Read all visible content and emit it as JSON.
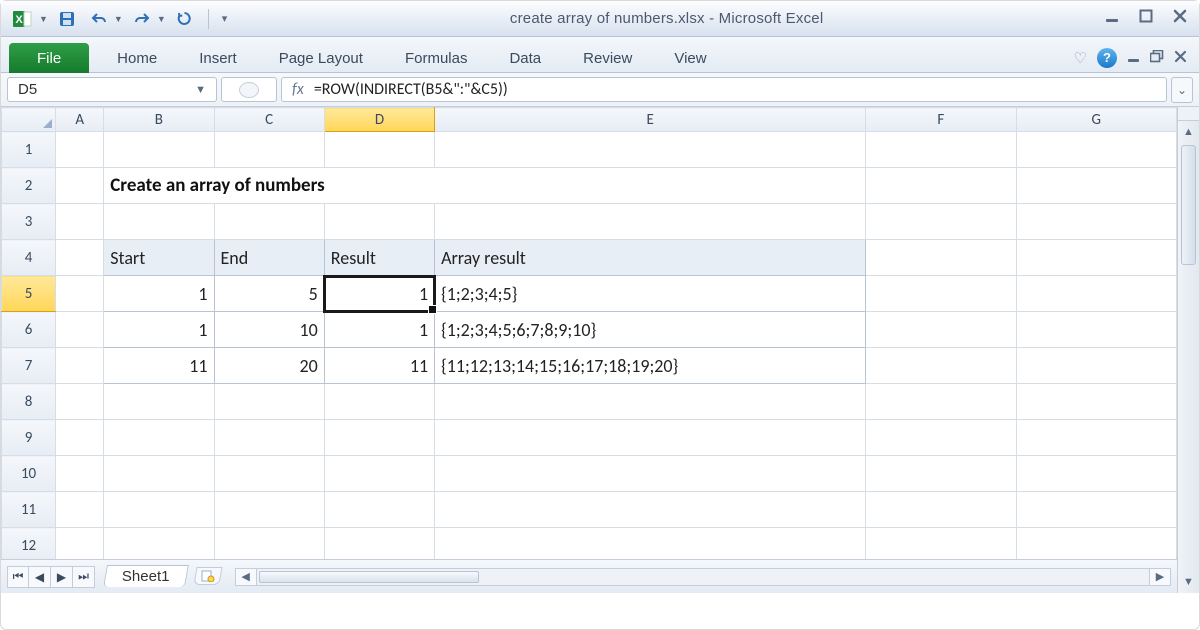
{
  "title": "create array of numbers.xlsx  -  Microsoft Excel",
  "ribbon": {
    "file": "File",
    "tabs": [
      "Home",
      "Insert",
      "Page Layout",
      "Formulas",
      "Data",
      "Review",
      "View"
    ]
  },
  "namebox": "D5",
  "fx_label": "fx",
  "formula": "=ROW(INDIRECT(B5&\":\"&C5))",
  "columns": [
    "A",
    "B",
    "C",
    "D",
    "E",
    "F",
    "G"
  ],
  "rows": [
    "1",
    "2",
    "3",
    "4",
    "5",
    "6",
    "7",
    "8",
    "9",
    "10",
    "11",
    "12"
  ],
  "sheet": {
    "title_cell": "Create an array of numbers",
    "headers": {
      "start": "Start",
      "end": "End",
      "result": "Result",
      "array": "Array result"
    },
    "data": [
      {
        "start": "1",
        "end": "5",
        "result": "1",
        "array": "{1;2;3;4;5}"
      },
      {
        "start": "1",
        "end": "10",
        "result": "1",
        "array": "{1;2;3;4;5;6;7;8;9;10}"
      },
      {
        "start": "11",
        "end": "20",
        "result": "11",
        "array": "{11;12;13;14;15;16;17;18;19;20}"
      }
    ]
  },
  "sheet_tab": "Sheet1"
}
